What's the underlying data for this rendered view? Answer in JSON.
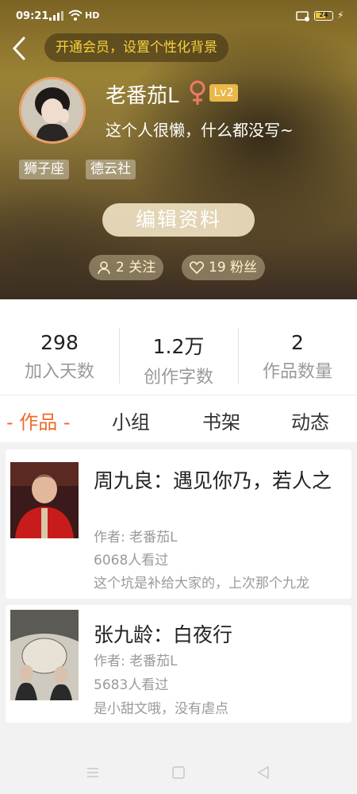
{
  "status_bar": {
    "time": "09:21",
    "network": "HD",
    "battery": "24"
  },
  "header": {
    "vip_banner": "开通会员，设置个性化背景",
    "username": "老番茄L",
    "level": "Lv2",
    "bio": "这个人很懒，什么都没写~",
    "tags": [
      "狮子座",
      "德云社"
    ],
    "edit_button": "编辑资料",
    "following": "2 关注",
    "followers": "19 粉丝"
  },
  "stats": [
    {
      "value": "298",
      "label": "加入天数"
    },
    {
      "value": "1.2万",
      "label": "创作字数"
    },
    {
      "value": "2",
      "label": "作品数量"
    }
  ],
  "tabs": [
    {
      "label": "- 作品 -",
      "active": true
    },
    {
      "label": "小组",
      "active": false
    },
    {
      "label": "书架",
      "active": false
    },
    {
      "label": "动态",
      "active": false
    }
  ],
  "works": [
    {
      "title": "周九良：遇见你乃，若人之",
      "author": "作者: 老番茄L",
      "views": "6068人看过",
      "desc": "这个坑是补给大家的，上次那个九龙"
    },
    {
      "title": "张九龄：白夜行",
      "author": "作者: 老番茄L",
      "views": "5683人看过",
      "desc": "是小甜文哦，没有虐点"
    }
  ],
  "colors": {
    "accent": "#f06a2a",
    "vip_text": "#f6d23a",
    "level_badge": "#e9b74a"
  }
}
